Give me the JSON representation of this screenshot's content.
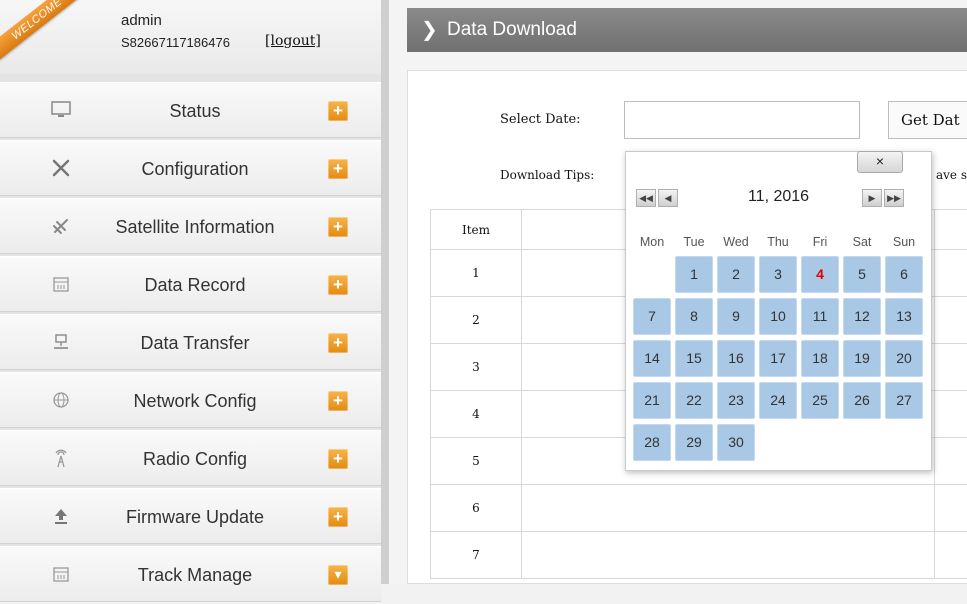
{
  "user": {
    "welcome_ribbon": "WELCOME",
    "name": "admin",
    "serial": "S82667117186476",
    "logout_label": "[logout]"
  },
  "sidebar": {
    "items": [
      {
        "label": "Status",
        "icon": "monitor-icon",
        "toggle": "+"
      },
      {
        "label": "Configuration",
        "icon": "tools-icon",
        "toggle": "+"
      },
      {
        "label": "Satellite Information",
        "icon": "satellite-icon",
        "toggle": "+"
      },
      {
        "label": "Data Record",
        "icon": "calendar-icon",
        "toggle": "+"
      },
      {
        "label": "Data Transfer",
        "icon": "network-transfer-icon",
        "toggle": "+"
      },
      {
        "label": "Network Config",
        "icon": "globe-icon",
        "toggle": "+"
      },
      {
        "label": "Radio Config",
        "icon": "antenna-icon",
        "toggle": "+"
      },
      {
        "label": "Firmware Update",
        "icon": "upload-icon",
        "toggle": "+"
      },
      {
        "label": "Track Manage",
        "icon": "calendar-icon",
        "toggle": "▾"
      }
    ]
  },
  "main": {
    "header_title": "Data Download",
    "select_date_label": "Select Date:",
    "date_input_value": "",
    "get_button_label": "Get Dat",
    "download_tips_label": "Download Tips:",
    "download_tips_tail": "ave s",
    "table": {
      "header_item": "Item",
      "rows": [
        "1",
        "2",
        "3",
        "4",
        "5",
        "6",
        "7"
      ]
    }
  },
  "calendar": {
    "close_label": "×",
    "month_label": "11, 2016",
    "weekdays": [
      "Mon",
      "Tue",
      "Wed",
      "Thu",
      "Fri",
      "Sat",
      "Sun"
    ],
    "days": [
      "1",
      "2",
      "3",
      "4",
      "5",
      "6",
      "7",
      "8",
      "9",
      "10",
      "11",
      "12",
      "13",
      "14",
      "15",
      "16",
      "17",
      "18",
      "19",
      "20",
      "21",
      "22",
      "23",
      "24",
      "25",
      "26",
      "27",
      "28",
      "29",
      "30"
    ],
    "first_weekday_index": 1,
    "today": "4",
    "colors": {
      "day_bg": "#a9c8e6",
      "today_text": "#e00000",
      "accent_orange": "#f29a25"
    }
  }
}
